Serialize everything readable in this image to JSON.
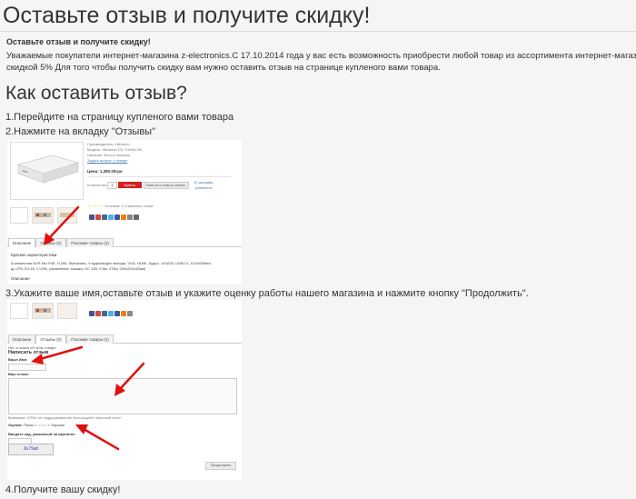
{
  "page": {
    "title": "Оставьте отзыв и получите скидку!",
    "intro_heading": "Оставьте отзыв и получите скидку!",
    "intro_line1": "Уважаемые покупатели интернет-магазина z-electronics.C 17.10.2014 года у вас есть возможность приобрести любой товар из ассортимента интернет-магазина со",
    "intro_line2": "скидкой 5% Для того чтобы получить скидку вам нужно оставить отзыв на странице купленого вами товара.",
    "how_heading": "Как оставить отзыв?",
    "step1": "1.Перейдите на страницу купленого вами товара",
    "step2": "2.Нажмите на вкладку \"Отзывы\"",
    "step3": "3.Укажите ваше имя,оставьте отзыв и укажите оценку работы нашего магазина и нажмите кнопку \"Продолжить\".",
    "step4": "4.Получите вашу скидку!"
  },
  "screenshot1": {
    "manufacturer": "Производитель: Hikvision",
    "model": "Модель: Hikvision DS-7104NI-SN",
    "availability": "Наличие: Есть в наличии",
    "ask_question": "Задать вопрос о товаре",
    "price": "Цена: 1,380.00грн",
    "qty_label": "Количество:",
    "qty_value": "1",
    "buy_button": "Купить",
    "wishlist_button": "Внести в список желан.",
    "compare_link": "В закладки",
    "compare_link2": "сравнение",
    "reviews_link": "Отзывов: 0 | Написать отзыв",
    "tabs": [
      "Описание",
      "Отзывы (0)",
      "Похожие товары (2)"
    ],
    "desc_heading": "Краткие характеристики",
    "desc_text": "8-канальная NVR без PoE, H.264, 5мегапикс, 4 аудио/видео выхода, VGA, HDMI, Аудио, 1xSATA, USB2.0, 10/100Mbit/s",
    "desc_text2": "до 4ТБ, RJ-45, 2 USB, управление, мышка, DC 12В, 0,5кг, 4ТБ(x 200x200x42мм)",
    "desc_footer": "Описание"
  },
  "screenshot2": {
    "tabs": [
      "Описание",
      "Отзывы (0)",
      "Похожие товары (2)"
    ],
    "no_reviews": "Нет отзывов об этом товаре.",
    "write_review": "Написать отзыв",
    "name_label": "Ваше Имя:",
    "review_label": "Ваш отзыв:",
    "note": "Внимание: HTML не поддерживается! Используйте обычный текст!",
    "rating_label": "Оценка:",
    "rating_bad": "Плохо",
    "rating_good": "Хорошо",
    "captcha_label": "Введите код, указанный на картинке:",
    "captcha_code": "3e79ab",
    "continue_button": "Продолжить"
  },
  "colors": {
    "accent_red": "#d42020",
    "link_blue": "#4a7bb8",
    "text": "#333333"
  }
}
